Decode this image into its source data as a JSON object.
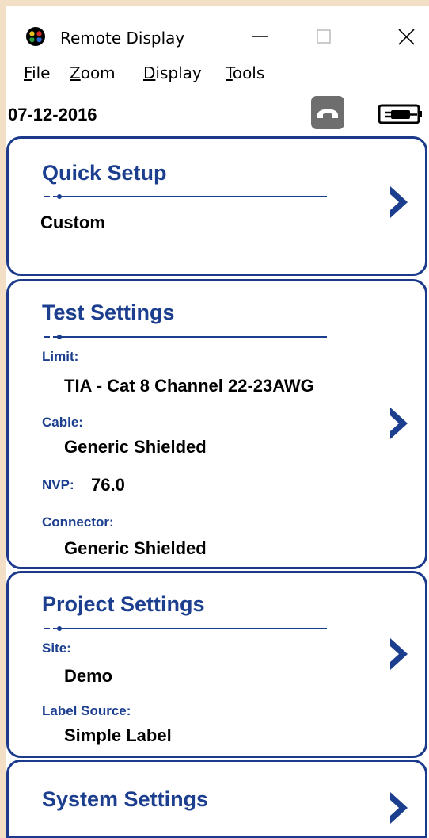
{
  "window": {
    "title": "Remote Display",
    "minimize_glyph": "—",
    "maximize_glyph": "☐",
    "close_glyph": "✕"
  },
  "menu": {
    "items": [
      {
        "accel": "F",
        "rest": "ile"
      },
      {
        "accel": "Z",
        "rest": "oom"
      },
      {
        "accel": "D",
        "rest": "isplay"
      },
      {
        "accel": "T",
        "rest": "ools"
      }
    ]
  },
  "status": {
    "date": "07-12-2016",
    "phone_icon": "phone-hangup-icon",
    "battery_icon": "battery-charging-icon"
  },
  "quick_setup": {
    "title": "Quick Setup",
    "value": "Custom"
  },
  "test_settings": {
    "title": "Test Settings",
    "limit_label": "Limit:",
    "limit_value": "TIA - Cat 8 Channel 22-23AWG",
    "cable_label": "Cable:",
    "cable_value": "Generic Shielded",
    "nvp_label": "NVP:",
    "nvp_value": "76.0",
    "connector_label": "Connector:",
    "connector_value": "Generic Shielded"
  },
  "project_settings": {
    "title": "Project Settings",
    "site_label": "Site:",
    "site_value": "Demo",
    "label_source_label": "Label Source:",
    "label_source_value": "Simple Label"
  },
  "system_settings": {
    "title": "System Settings"
  },
  "colors": {
    "accent": "#1c3e8f",
    "window_border": "#f3dfc6",
    "phone_button": "#6e6e6e"
  }
}
